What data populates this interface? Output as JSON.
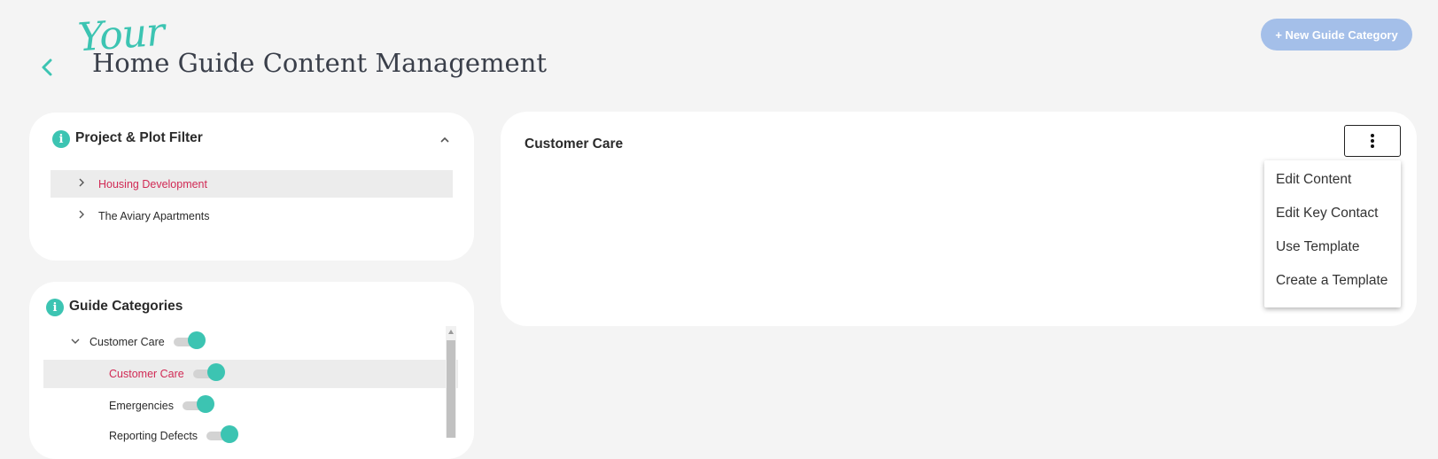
{
  "header": {
    "back_icon": "chevron-left-icon",
    "script_text": "Your",
    "title": "Home Guide Content Management",
    "new_category_label": "+ New Guide Category"
  },
  "filter": {
    "title": "Project & Plot Filter",
    "info_icon": "info-icon",
    "collapse_icon": "chevron-up-icon",
    "items": [
      {
        "label": "Housing Development",
        "selected": true
      },
      {
        "label": "The Aviary Apartments",
        "selected": false
      }
    ]
  },
  "categories": {
    "title": "Guide Categories",
    "items": [
      {
        "label": "Customer Care",
        "level": 0,
        "expanded": true,
        "enabled": true
      },
      {
        "label": "Customer Care",
        "level": 1,
        "selected": true,
        "enabled": true
      },
      {
        "label": "Emergencies",
        "level": 1,
        "enabled": true
      },
      {
        "label": "Reporting Defects",
        "level": 1,
        "enabled": true
      }
    ]
  },
  "content": {
    "title": "Customer Care",
    "menu_icon": "more-vertical-icon",
    "menu_items": [
      "Edit Content",
      "Edit Key Contact",
      "Use Template",
      "Create a Template"
    ]
  },
  "colors": {
    "accent": "#3cc4b2",
    "selected_text": "#d12a55",
    "primary_button": "#a4bfe9",
    "background": "#f4f4f4"
  }
}
